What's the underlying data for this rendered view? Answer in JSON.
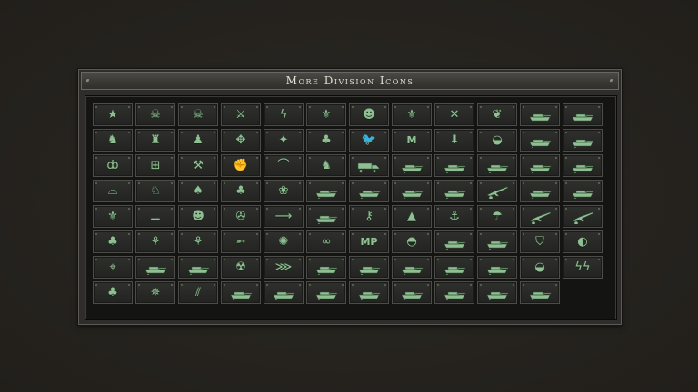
{
  "window": {
    "title": "More Division Icons"
  },
  "accent_color": "#8fbf92",
  "icons": [
    {
      "name": "star-icon",
      "glyph": "★"
    },
    {
      "name": "skull-icon",
      "glyph": "☠"
    },
    {
      "name": "winged-skull-icon",
      "glyph": "☠"
    },
    {
      "name": "crossed-rifles-icon",
      "glyph": "⚔"
    },
    {
      "name": "lightning-icon",
      "glyph": "ϟ"
    },
    {
      "name": "winged-emblem-icon",
      "glyph": "⚜"
    },
    {
      "name": "cat-mask-icon",
      "glyph": "☻"
    },
    {
      "name": "winged-sword-icon",
      "glyph": "⚜"
    },
    {
      "name": "crossed-swords-icon",
      "glyph": "✕"
    },
    {
      "name": "laurel-wreath-icon",
      "glyph": "❦"
    },
    {
      "name": "tank-icon",
      "glyph": "tank"
    },
    {
      "name": "tank-icon",
      "glyph": "tank"
    },
    {
      "name": "chess-knight-icon",
      "glyph": "♞"
    },
    {
      "name": "chess-rook-icon",
      "glyph": "♜"
    },
    {
      "name": "chess-pawn-icon",
      "glyph": "♟"
    },
    {
      "name": "compass-rose-icon",
      "glyph": "✥"
    },
    {
      "name": "four-point-star-icon",
      "glyph": "✦"
    },
    {
      "name": "palm-island-icon",
      "glyph": "♣"
    },
    {
      "name": "bird-icon",
      "glyph": "🐦"
    },
    {
      "name": "letter-m-icon",
      "glyph": "M",
      "text": true
    },
    {
      "name": "down-arrow-icon",
      "glyph": "⬇"
    },
    {
      "name": "helmet-icon",
      "glyph": "◒"
    },
    {
      "name": "heavy-tank-icon",
      "glyph": "tank"
    },
    {
      "name": "heavy-tank-icon",
      "glyph": "tank"
    },
    {
      "name": "chi-symbol-icon",
      "glyph": "ȸ"
    },
    {
      "name": "grid-target-icon",
      "glyph": "⊞"
    },
    {
      "name": "crossed-tools-icon",
      "glyph": "⚒"
    },
    {
      "name": "fist-icon",
      "glyph": "✊"
    },
    {
      "name": "arc-icon",
      "glyph": "⌒"
    },
    {
      "name": "horse-icon",
      "glyph": "♞"
    },
    {
      "name": "truck-icon",
      "glyph": "truck"
    },
    {
      "name": "apc-icon",
      "glyph": "tank"
    },
    {
      "name": "tank-icon",
      "glyph": "tank"
    },
    {
      "name": "tank-icon",
      "glyph": "tank"
    },
    {
      "name": "tank-icon",
      "glyph": "tank"
    },
    {
      "name": "tank-icon",
      "glyph": "tank"
    },
    {
      "name": "rainbow-icon",
      "glyph": "⌓"
    },
    {
      "name": "unicorn-icon",
      "glyph": "♘"
    },
    {
      "name": "spade-icon",
      "glyph": "♠"
    },
    {
      "name": "clover-icon",
      "glyph": "♣"
    },
    {
      "name": "paw-icon",
      "glyph": "❀"
    },
    {
      "name": "tank-icon",
      "glyph": "tank"
    },
    {
      "name": "heavy-tank-icon",
      "glyph": "tank"
    },
    {
      "name": "tank-icon",
      "glyph": "tank"
    },
    {
      "name": "self-propelled-gun-icon",
      "glyph": "tank"
    },
    {
      "name": "artillery-icon",
      "glyph": "gun"
    },
    {
      "name": "tank-destroyer-icon",
      "glyph": "tank"
    },
    {
      "name": "light-tank-icon",
      "glyph": "tank"
    },
    {
      "name": "eagle-icon",
      "glyph": "⚜"
    },
    {
      "name": "sword-icon",
      "glyph": "⚊"
    },
    {
      "name": "cat-head-icon",
      "glyph": "☻"
    },
    {
      "name": "wheel-icon",
      "glyph": "✇"
    },
    {
      "name": "arrow-icon",
      "glyph": "⟶"
    },
    {
      "name": "long-gun-tank-icon",
      "glyph": "tank"
    },
    {
      "name": "key-icon",
      "glyph": "⚷"
    },
    {
      "name": "mountain-icon",
      "glyph": "▲"
    },
    {
      "name": "anchor-icon",
      "glyph": "⚓"
    },
    {
      "name": "parachute-icon",
      "glyph": "☂"
    },
    {
      "name": "field-gun-icon",
      "glyph": "gun"
    },
    {
      "name": "anti-tank-gun-icon",
      "glyph": "gun"
    },
    {
      "name": "palm-tree-icon",
      "glyph": "♣"
    },
    {
      "name": "eagle-head-icon",
      "glyph": "⚘"
    },
    {
      "name": "wolf-head-icon",
      "glyph": "⚘"
    },
    {
      "name": "rocket-icon",
      "glyph": "➵"
    },
    {
      "name": "explosion-icon",
      "glyph": "✺"
    },
    {
      "name": "binoculars-icon",
      "glyph": "∞"
    },
    {
      "name": "military-police-icon",
      "glyph": "MP",
      "text": true
    },
    {
      "name": "helmet-icon",
      "glyph": "◓"
    },
    {
      "name": "tank-icon",
      "glyph": "tank"
    },
    {
      "name": "tank-icon",
      "glyph": "tank"
    },
    {
      "name": "shield-icon",
      "glyph": "⛉"
    },
    {
      "name": "wave-icon",
      "glyph": "◐"
    },
    {
      "name": "crosshair-icon",
      "glyph": "⌖"
    },
    {
      "name": "skull-tank-icon",
      "glyph": "tank"
    },
    {
      "name": "fast-tank-icon",
      "glyph": "tank"
    },
    {
      "name": "eagle-emblem-icon",
      "glyph": "☢"
    },
    {
      "name": "shark-icon",
      "glyph": "⋙"
    },
    {
      "name": "tank-icon",
      "glyph": "tank"
    },
    {
      "name": "tank-icon",
      "glyph": "tank"
    },
    {
      "name": "spg-icon",
      "glyph": "tank"
    },
    {
      "name": "tank-icon",
      "glyph": "tank"
    },
    {
      "name": "heavy-tank-icon",
      "glyph": "tank"
    },
    {
      "name": "soldier-helmet-icon",
      "glyph": "◒"
    },
    {
      "name": "ss-runes-icon",
      "glyph": "ϟϟ"
    },
    {
      "name": "palm-trees-icon",
      "glyph": "♣"
    },
    {
      "name": "ruined-tank-icon",
      "glyph": "✵"
    },
    {
      "name": "claw-marks-icon",
      "glyph": "⫽"
    },
    {
      "name": "light-tank-icon",
      "glyph": "tank"
    },
    {
      "name": "light-tank-icon",
      "glyph": "tank"
    },
    {
      "name": "tank-icon",
      "glyph": "tank"
    },
    {
      "name": "tank-icon",
      "glyph": "tank"
    },
    {
      "name": "tank-icon",
      "glyph": "tank"
    },
    {
      "name": "tank-icon",
      "glyph": "tank"
    },
    {
      "name": "tank-icon",
      "glyph": "tank"
    },
    {
      "name": "heavy-tank-icon",
      "glyph": "tank"
    }
  ]
}
